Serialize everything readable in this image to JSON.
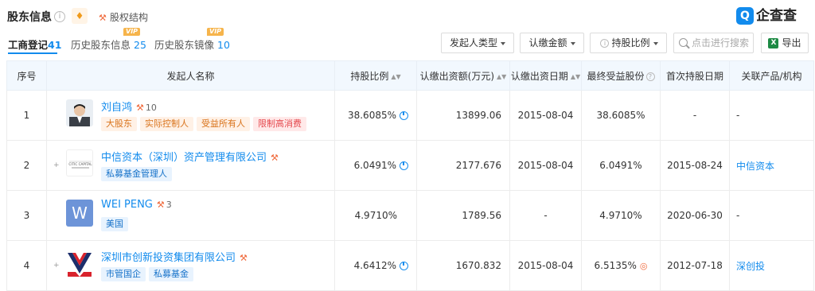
{
  "header": {
    "title": "股东信息",
    "equity_link": "股权结构",
    "brand": "企查查",
    "brand_mark": "Q"
  },
  "tabs": [
    {
      "label": "工商登记",
      "count": "41",
      "active": true,
      "vip": ""
    },
    {
      "label": "历史股东信息",
      "count": "25",
      "active": false,
      "vip": "VIP"
    },
    {
      "label": "历史股东镜像",
      "count": "10",
      "active": false,
      "vip": "VIP"
    }
  ],
  "filters": {
    "sponsor_type": "发起人类型",
    "subscribed_amount": "认缴金额",
    "holding_ratio": "持股比例",
    "search_placeholder": "点击进行搜索",
    "export": "导出"
  },
  "table": {
    "columns": [
      "序号",
      "发起人名称",
      "持股比例",
      "认缴出资额(万元)",
      "认缴出资日期",
      "最终受益股份",
      "首次持股日期",
      "关联产品/机构"
    ],
    "rows": [
      {
        "index": "1",
        "name": "刘自鸿",
        "relation_count": "10",
        "tags": [
          {
            "text": "大股东",
            "style": "orange"
          },
          {
            "text": "实际控制人",
            "style": "orange"
          },
          {
            "text": "受益所有人",
            "style": "orange"
          },
          {
            "text": "限制高消费",
            "style": "red"
          }
        ],
        "ratio": "38.6085%",
        "amount": "13899.06",
        "date": "2015-08-04",
        "beneficial": "38.6085%",
        "first_date": "-",
        "product": "-"
      },
      {
        "index": "2",
        "name": "中信资本（深圳）资产管理有限公司",
        "relation_count": "",
        "tags": [
          {
            "text": "私募基金管理人",
            "style": "blue"
          }
        ],
        "ratio": "6.0491%",
        "amount": "2177.676",
        "date": "2015-08-04",
        "beneficial": "6.0491%",
        "first_date": "2015-08-24",
        "product": "中信资本"
      },
      {
        "index": "3",
        "name": "WEI PENG",
        "relation_count": "3",
        "tags": [
          {
            "text": "美国",
            "style": "blue"
          }
        ],
        "ratio": "4.9710%",
        "amount": "1789.56",
        "date": "-",
        "beneficial": "4.9710%",
        "first_date": "2020-06-30",
        "product": "-"
      },
      {
        "index": "4",
        "name": "深圳市创新投资集团有限公司",
        "relation_count": "",
        "tags": [
          {
            "text": "市管国企",
            "style": "blue"
          },
          {
            "text": "私募基金",
            "style": "blue"
          }
        ],
        "ratio": "4.6412%",
        "amount": "1670.832",
        "date": "2015-08-04",
        "beneficial": "6.5135%",
        "first_date": "2012-07-18",
        "product": "深创投"
      }
    ],
    "avatar_letter_row3": "W",
    "citic_logo_text": "CITIC CAPITAL"
  }
}
